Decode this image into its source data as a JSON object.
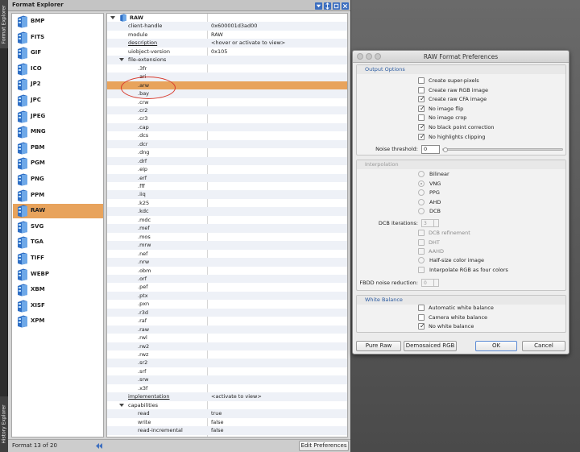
{
  "side_tabs": {
    "format_explorer": "Format Explorer",
    "history_explorer": "History Explorer"
  },
  "explorer": {
    "title": "Format Explorer",
    "formats": [
      "BMP",
      "FITS",
      "GIF",
      "ICO",
      "JP2",
      "JPC",
      "JPEG",
      "MNG",
      "PBM",
      "PGM",
      "PNG",
      "PPM",
      "RAW",
      "SVG",
      "TGA",
      "TIFF",
      "WEBP",
      "XBM",
      "XISF",
      "XPM"
    ],
    "selected_format": "RAW",
    "footer": {
      "count": "Format 13 of 20",
      "edit_button": "Edit Preferences"
    }
  },
  "tree": {
    "root": "RAW",
    "props": [
      {
        "key": "client-handle",
        "value": "0x600001d3ad00"
      },
      {
        "key": "module",
        "value": "RAW"
      },
      {
        "key": "description",
        "value": "<hover or activate to view>"
      },
      {
        "key": "uiobject-version",
        "value": "0x105"
      }
    ],
    "file_extensions_label": "file-extensions",
    "extensions": [
      ".3fr",
      ".ari",
      ".arw",
      ".bay",
      ".crw",
      ".cr2",
      ".cr3",
      ".cap",
      ".dcs",
      ".dcr",
      ".dng",
      ".drf",
      ".eip",
      ".erf",
      ".fff",
      ".iiq",
      ".k25",
      ".kdc",
      ".mdc",
      ".mef",
      ".mos",
      ".mrw",
      ".nef",
      ".nrw",
      ".obm",
      ".orf",
      ".pef",
      ".ptx",
      ".pxn",
      ".r3d",
      ".raf",
      ".raw",
      ".rwl",
      ".rw2",
      ".rwz",
      ".sr2",
      ".srf",
      ".srw",
      ".x3f"
    ],
    "selected_extension": ".arw",
    "implementation": {
      "key": "implementation",
      "value": "<activate to view>"
    },
    "capabilities_label": "capabilities",
    "capabilities": [
      {
        "key": "read",
        "value": "true"
      },
      {
        "key": "write",
        "value": "false"
      },
      {
        "key": "read-incremental",
        "value": "false"
      },
      {
        "key": "",
        "value": "false"
      }
    ]
  },
  "dialog": {
    "title": "RAW Format Preferences",
    "output_options": {
      "header": "Output Options",
      "checkboxes": [
        {
          "label": "Create super-pixels",
          "checked": false
        },
        {
          "label": "Create raw RGB image",
          "checked": false
        },
        {
          "label": "Create raw CFA image",
          "checked": true
        },
        {
          "label": "No image flip",
          "checked": true
        },
        {
          "label": "No image crop",
          "checked": false
        },
        {
          "label": "No black point correction",
          "checked": true
        },
        {
          "label": "No highlights clipping",
          "checked": true
        }
      ],
      "noise_threshold_label": "Noise threshold:",
      "noise_threshold_value": "0"
    },
    "interpolation": {
      "header": "Interpolation",
      "radios": [
        {
          "label": "Bilinear",
          "selected": false
        },
        {
          "label": "VNG",
          "selected": true
        },
        {
          "label": "PPG",
          "selected": false
        },
        {
          "label": "AHD",
          "selected": false
        },
        {
          "label": "DCB",
          "selected": false
        }
      ],
      "dcb_iterations_label": "DCB iterations:",
      "dcb_iterations_value": "3",
      "checkboxes": [
        {
          "label": "DCB refinement",
          "checked": false
        },
        {
          "label": "DHT",
          "checked": false
        },
        {
          "label": "AAHD",
          "checked": false
        }
      ],
      "half_size_label": "Half-size color image",
      "interp_rgb_label": "Interpolate RGB as four colors",
      "fbdd_label": "FBDD noise reduction:",
      "fbdd_value": "0"
    },
    "white_balance": {
      "header": "White Balance",
      "checkboxes": [
        {
          "label": "Automatic white balance",
          "checked": false
        },
        {
          "label": "Camera white balance",
          "checked": false
        },
        {
          "label": "No white balance",
          "checked": true
        }
      ]
    },
    "buttons": {
      "pure_raw": "Pure Raw",
      "demosaiced": "Demosaiced RGB",
      "ok": "OK",
      "cancel": "Cancel"
    }
  }
}
